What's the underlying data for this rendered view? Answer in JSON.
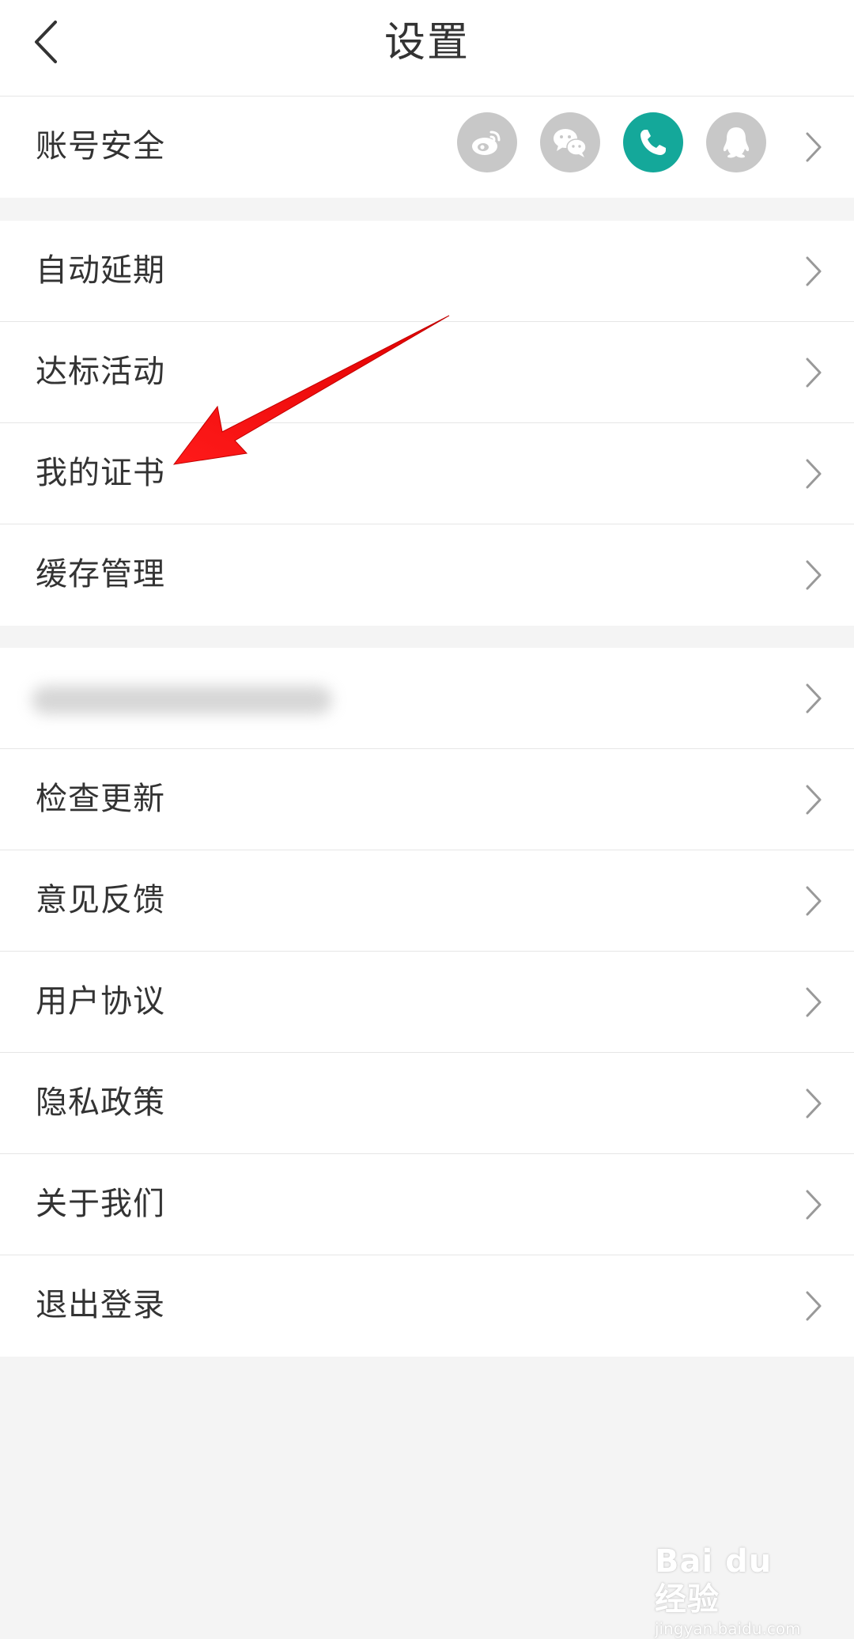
{
  "header": {
    "title": "设置",
    "back_icon": "chevron-left-icon"
  },
  "account_row": {
    "label": "账号安全",
    "linked_accounts": [
      {
        "icon": "weibo-icon",
        "active": false
      },
      {
        "icon": "wechat-icon",
        "active": false
      },
      {
        "icon": "phone-icon",
        "active": true
      },
      {
        "icon": "qq-icon",
        "active": false
      }
    ],
    "colors": {
      "active": "#14a89a",
      "inactive": "#c8c8c8"
    }
  },
  "group1": {
    "items": [
      {
        "label": "自动延期"
      },
      {
        "label": "达标活动"
      },
      {
        "label": "我的证书"
      },
      {
        "label": "缓存管理"
      }
    ]
  },
  "group2": {
    "items": [
      {
        "label": "",
        "redacted": true
      },
      {
        "label": "检查更新"
      },
      {
        "label": "意见反馈"
      },
      {
        "label": "用户协议"
      },
      {
        "label": "隐私政策"
      },
      {
        "label": "关于我们"
      },
      {
        "label": "退出登录"
      }
    ]
  },
  "annotation": {
    "type": "red-arrow",
    "color": "#ff1a1a",
    "points_to": "我的证书"
  },
  "watermark": {
    "logo": "Bai du 经验",
    "url": "jingyan.baidu.com"
  }
}
